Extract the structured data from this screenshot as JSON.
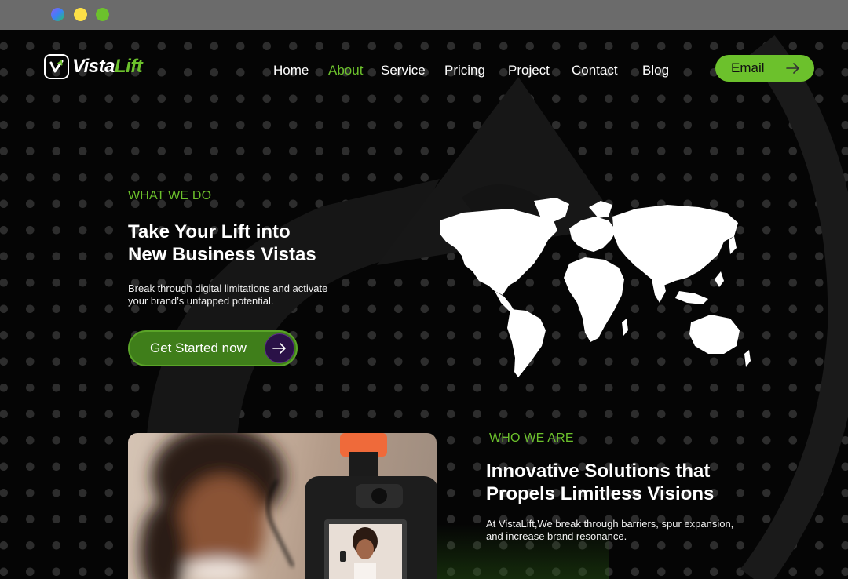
{
  "brand": {
    "name_part1": "Vista",
    "name_part2": "Lift",
    "accent_color": "#6cc12c"
  },
  "nav": {
    "items": [
      {
        "label": "Home",
        "active": false
      },
      {
        "label": "About",
        "active": true
      },
      {
        "label": "Service",
        "active": false
      },
      {
        "label": "Pricing",
        "active": false
      },
      {
        "label": "Project",
        "active": false
      },
      {
        "label": "Contact",
        "active": false
      },
      {
        "label": "Blog",
        "active": false
      }
    ],
    "cta_label": "Email",
    "cta_icon": "arrow-right-icon"
  },
  "hero": {
    "eyebrow": "WHAT WE DO",
    "title_line1": "Take Your Lift into",
    "title_line2": "New Business Vistas",
    "subtitle_line1": "Break through digital limitations and activate",
    "subtitle_line2": "your brand’s untapped potential.",
    "cta_label": "Get Started now",
    "cta_icon": "arrow-right-icon",
    "illustration": "world-map"
  },
  "about": {
    "eyebrow": "WHO WE ARE",
    "title_line1": "Innovative Solutions that",
    "title_line2": "Propels Limitless Visions",
    "subtitle_line1": "At VistaLift,We break through barriers, spur expansion,",
    "subtitle_line2": "and increase brand resonance.",
    "image": "woman-filming-with-camera-photo"
  }
}
